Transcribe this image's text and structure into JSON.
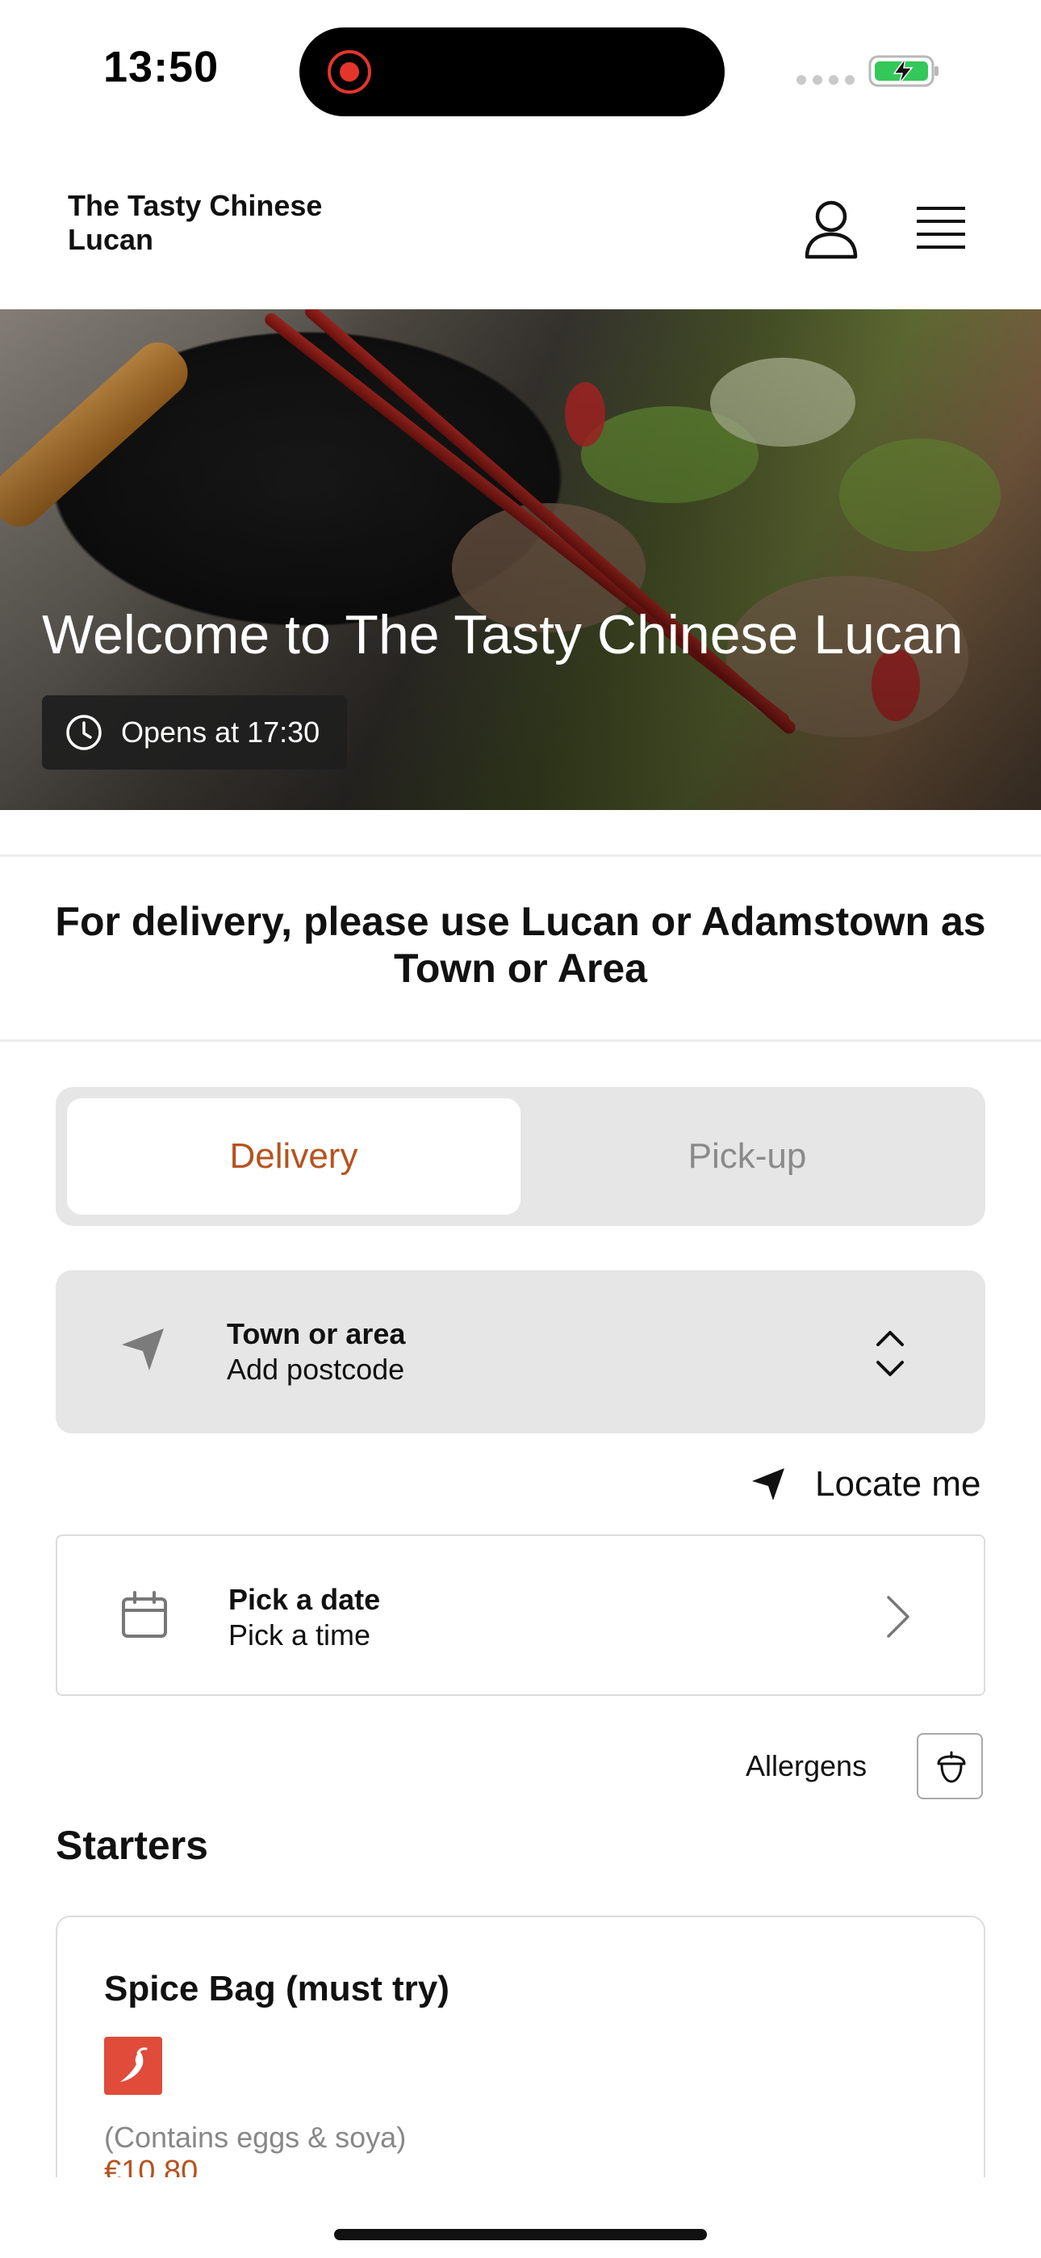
{
  "status_bar": {
    "time": "13:50"
  },
  "header": {
    "restaurant_name": "The Tasty Chinese Lucan",
    "account_icon": "person-icon",
    "menu_icon": "hamburger-menu-icon"
  },
  "hero": {
    "title": "Welcome to The Tasty Chinese Lucan",
    "opening_status": "Opens at 17:30"
  },
  "notice": "For delivery, please use Lucan or Adamstown as Town or Area",
  "order_mode": {
    "options": [
      "Delivery",
      "Pick-up"
    ],
    "selected": "Delivery"
  },
  "address": {
    "title": "Town or area",
    "subtitle": "Add postcode"
  },
  "locate_me": "Locate me",
  "schedule": {
    "title": "Pick a date",
    "subtitle": "Pick a time"
  },
  "allergens_label": "Allergens",
  "menu": {
    "section_title": "Starters",
    "items": [
      {
        "name": "Spice Bag (must try)",
        "description": "(Contains eggs & soya)",
        "price": "€10.80",
        "badge": "chili-icon"
      }
    ]
  },
  "colors": {
    "accent": "#b5531f",
    "segment_background": "#e6e6e6",
    "chili_badge": "#e04b3a"
  }
}
